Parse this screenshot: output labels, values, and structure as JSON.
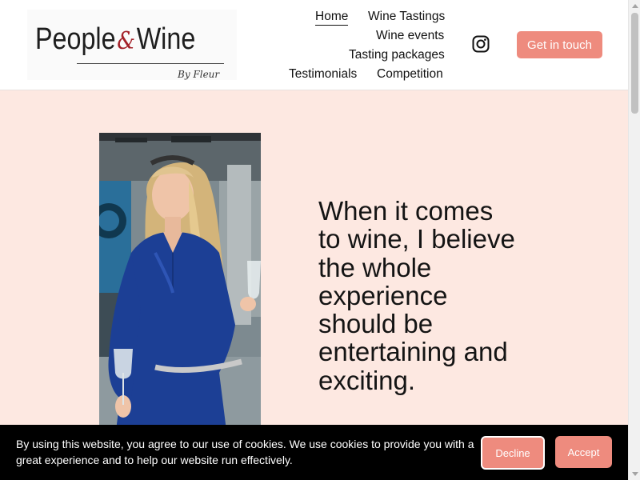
{
  "header": {
    "logo": {
      "main_left": "People",
      "ampersand": "&",
      "main_right": "Wine",
      "sub": "By Fleur"
    },
    "nav": {
      "home": "Home",
      "wine_tastings": "Wine Tastings",
      "wine_events": "Wine events",
      "tasting_packages": "Tasting packages",
      "testimonials": "Testimonials",
      "competition": "Competition"
    },
    "social_icon": "instagram-icon",
    "cta_label": "Get in touch"
  },
  "hero": {
    "heading": "When it comes to wine, I believe the whole experience should be entertaining and exciting."
  },
  "cookie_banner": {
    "text": "By using this website, you agree to our use of cookies. We use cookies to provide you with a great experience and to help our website run effectively.",
    "decline_label": "Decline",
    "accept_label": "Accept"
  },
  "colors": {
    "accent": "#ee8b7e",
    "page_background": "#fde8e1",
    "banner_background": "#000000",
    "logo_ampersand": "#a32028"
  }
}
